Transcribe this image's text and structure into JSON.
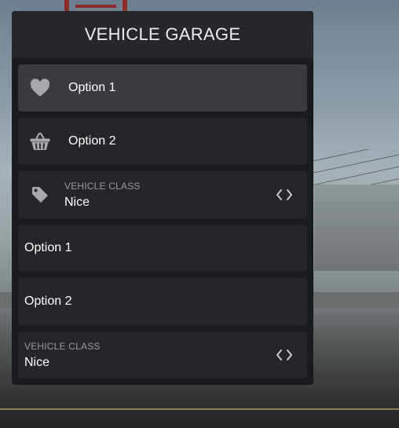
{
  "menu": {
    "title": "VEHICLE GARAGE",
    "items": [
      {
        "type": "button",
        "icon": "heart-icon",
        "label": "Option 1",
        "selected": true
      },
      {
        "type": "button",
        "icon": "basket-icon",
        "label": "Option 2"
      },
      {
        "type": "selector",
        "icon": "tag-icon",
        "sub_label": "VEHICLE CLASS",
        "value": "Nice",
        "control_icon": "left-right-arrows-icon"
      },
      {
        "type": "button",
        "label": "Option 1"
      },
      {
        "type": "button",
        "label": "Option 2"
      },
      {
        "type": "selector",
        "sub_label": "VEHICLE CLASS",
        "value": "Nice",
        "control_icon": "left-right-arrows-icon"
      }
    ]
  },
  "colors": {
    "panel_bg": "#1a1b1f",
    "header_bg": "#26272b",
    "item_bg": "#25262a",
    "item_selected_bg": "#3a3b40",
    "icon": "#a7a8ab",
    "sub_label": "#9a9ba0"
  }
}
